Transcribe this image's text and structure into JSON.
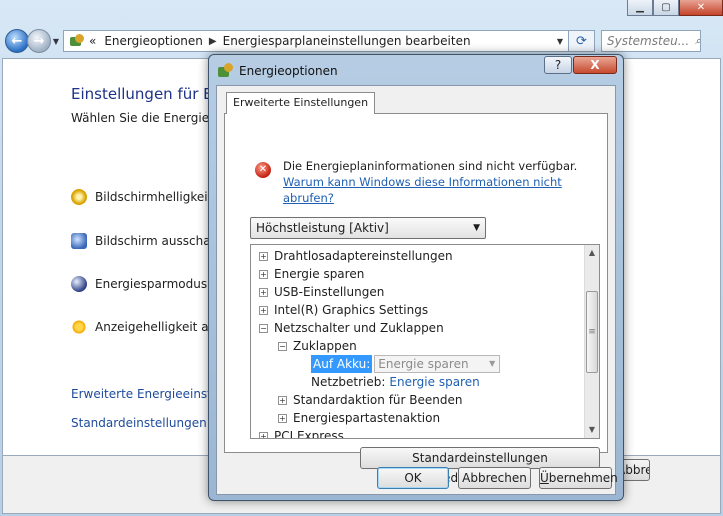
{
  "explorer": {
    "address": {
      "overflow": "«",
      "crumbs": [
        "Energieoptionen",
        "Energiesparplaneinstellungen bearbeiten"
      ]
    },
    "search_placeholder": "Systemsteu...",
    "page_title": "Einstellungen für Energ",
    "page_subtitle": "Wählen Sie die Energiespa",
    "settings": [
      {
        "label": "Bildschirmhelligkeit re",
        "icon": "brightness-icon"
      },
      {
        "label": "Bildschirm ausschalte",
        "icon": "display-icon"
      },
      {
        "label": "Energiesparmodus na",
        "icon": "sleep-icon"
      },
      {
        "label": "Anzeigehelligkeit anp",
        "icon": "sun-icon"
      }
    ],
    "links": [
      "Erweiterte Energieeinstellu",
      "Standardeinstellungen für"
    ],
    "cancel_button_partial": "Abbrechen"
  },
  "dialog": {
    "title": "Energieoptionen",
    "help_label": "?",
    "close_label": "X",
    "tab_label": "Erweiterte Einstellungen",
    "error": {
      "text": "Die Energieplaninformationen sind nicht verfügbar.",
      "link": "Warum kann Windows diese Informationen nicht abrufen?"
    },
    "plan_select": "Höchstleistung [Aktiv]",
    "tree": {
      "items": [
        {
          "label": "Drahtlosadaptereinstellungen",
          "toggle": "+"
        },
        {
          "label": "Energie sparen",
          "toggle": "+"
        },
        {
          "label": "USB-Einstellungen",
          "toggle": "+"
        },
        {
          "label": "Intel(R) Graphics Settings",
          "toggle": "+"
        },
        {
          "label": "Netzschalter und Zuklappen",
          "toggle": "−"
        },
        {
          "label": "Zuklappen",
          "toggle": "−"
        },
        {
          "label": "Standardaktion für Beenden",
          "toggle": "+"
        },
        {
          "label": "Energiespartastenaktion",
          "toggle": "+"
        },
        {
          "label": "PCI Express",
          "toggle": "+"
        }
      ],
      "akku_label": "Auf Akku:",
      "akku_value": "Energie sparen",
      "netz_label": "Netzbetrieb:",
      "netz_value": "Energie sparen"
    },
    "restore_button": "Standardeinstellungen wiederherstellen",
    "ok_button": "OK",
    "cancel_button": "Abbrechen",
    "apply_button_prefix": "Ü",
    "apply_button_rest": "bernehmen"
  }
}
